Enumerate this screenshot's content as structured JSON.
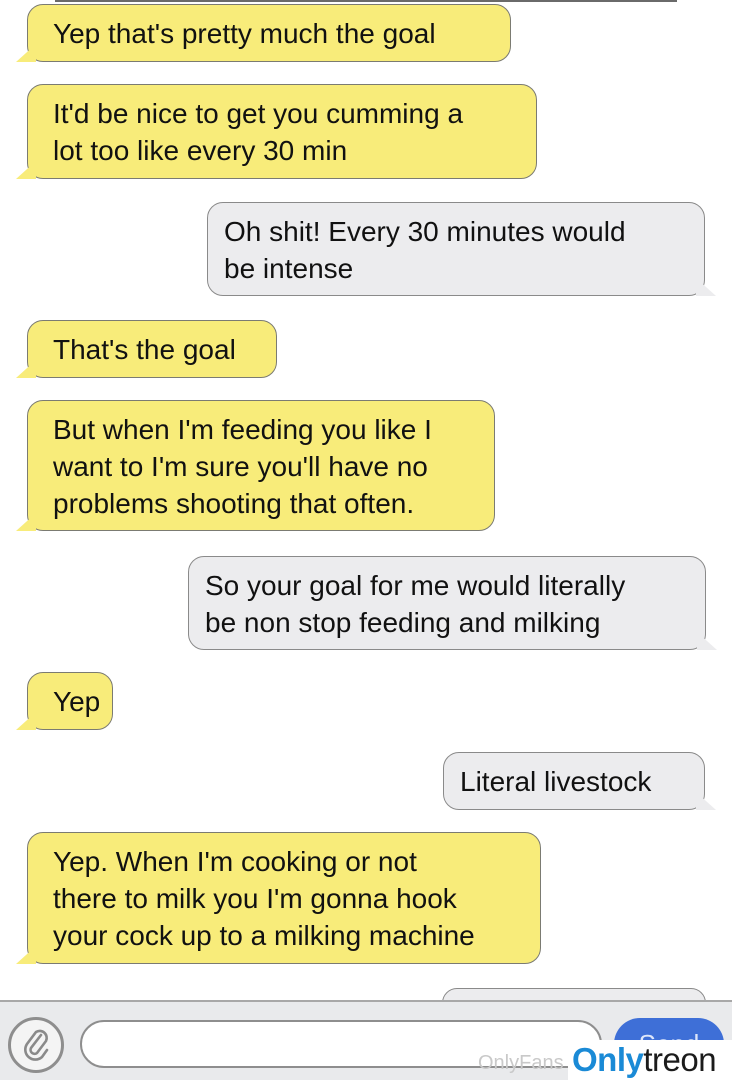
{
  "messages": [
    {
      "from": "them",
      "lines": [
        "Yep that's pretty much the goal"
      ]
    },
    {
      "from": "them",
      "lines": [
        "It'd be nice to get you cumming a",
        "lot too like every 30 min"
      ]
    },
    {
      "from": "me",
      "lines": [
        "Oh shit! Every 30 minutes would",
        "be intense"
      ]
    },
    {
      "from": "them",
      "lines": [
        "That's the goal"
      ]
    },
    {
      "from": "them",
      "lines": [
        "But when I'm feeding you like I",
        "want to I'm sure you'll have no",
        "problems shooting that often."
      ]
    },
    {
      "from": "me",
      "lines": [
        "So your goal for me would literally",
        "be non stop feeding and milking"
      ]
    },
    {
      "from": "them",
      "lines": [
        "Yep"
      ]
    },
    {
      "from": "me",
      "lines": [
        "Literal livestock"
      ]
    },
    {
      "from": "them",
      "lines": [
        "Yep. When I'm cooking or not",
        "there to milk you I'm gonna hook",
        "your cock up to a milking machine"
      ]
    }
  ],
  "composer": {
    "attach_icon": "paperclip-icon",
    "input_value": "",
    "send_label": "Send"
  },
  "watermark": {
    "faint": "OnlyFans",
    "brand_part1": "Only",
    "brand_part2": "treon"
  },
  "colors": {
    "incoming_bubble": "#f8ec7a",
    "outgoing_bubble": "#ececee",
    "send_button": "#3e6fd7",
    "brand_blue": "#1a8ad6"
  }
}
